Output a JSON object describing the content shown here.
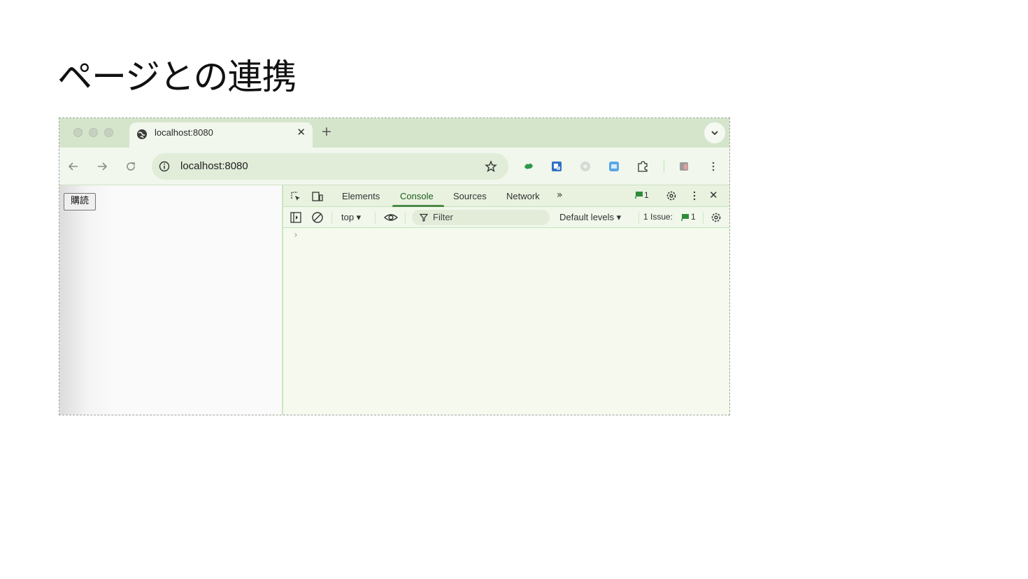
{
  "slide": {
    "title": "ページとの連携"
  },
  "browser": {
    "tab": {
      "title": "localhost:8080",
      "close": "✕"
    },
    "new_tab": "+",
    "omnibox": {
      "url": "localhost:8080"
    }
  },
  "page": {
    "button_label": "購読"
  },
  "devtools": {
    "tabs": [
      "Elements",
      "Console",
      "Sources",
      "Network"
    ],
    "active_tab": "Console",
    "more_tabs": "»",
    "issues_badge_count": "1",
    "close": "✕",
    "console_toolbar": {
      "context": "top ▾",
      "filter_placeholder": "Filter",
      "levels": "Default levels ▾",
      "issues_label": "1 Issue:",
      "issues_count": "1"
    },
    "prompt": "›"
  },
  "colors": {
    "accent_green": "#4a8a46",
    "tabstrip": "#d5e5cc",
    "devtools_bg": "#f5f9ee"
  }
}
